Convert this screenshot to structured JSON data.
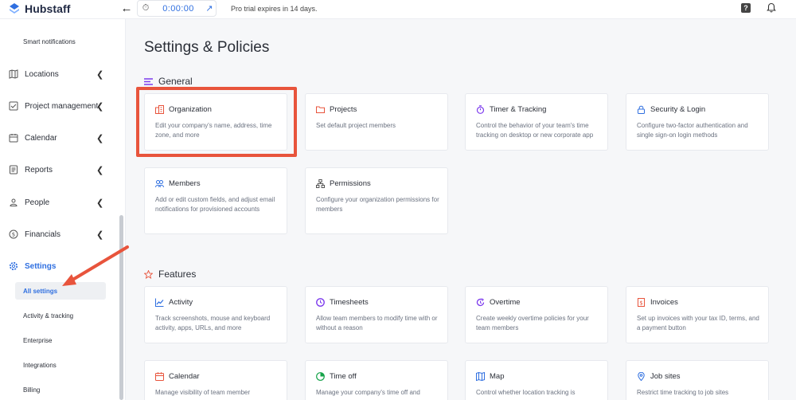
{
  "app": {
    "name": "Hubstaff"
  },
  "topbar": {
    "timer_value": "0:00:00",
    "trial_text": "Pro trial expires in 14 days.",
    "back_icon": "arrow-left-icon",
    "help_icon": "question-icon",
    "help_glyph": "?",
    "notifications_icon": "bell-icon"
  },
  "sidebar": {
    "smart_notifications": "Smart notifications",
    "items": [
      {
        "label": "Locations",
        "icon": "map-icon"
      },
      {
        "label": "Project management",
        "icon": "checklist-icon"
      },
      {
        "label": "Calendar",
        "icon": "calendar-icon"
      },
      {
        "label": "Reports",
        "icon": "report-icon"
      },
      {
        "label": "People",
        "icon": "person-icon"
      },
      {
        "label": "Financials",
        "icon": "dollar-icon"
      },
      {
        "label": "Settings",
        "icon": "gear-icon"
      }
    ],
    "sub_items": [
      {
        "label": "All settings",
        "active": true
      },
      {
        "label": "Activity & tracking"
      },
      {
        "label": "Enterprise"
      },
      {
        "label": "Integrations"
      },
      {
        "label": "Billing"
      }
    ]
  },
  "main": {
    "title": "Settings & Policies",
    "general": {
      "title": "General",
      "cards": [
        {
          "title": "Organization",
          "desc": "Edit your company's name, address, time zone, and more",
          "icon": "building-icon",
          "color": "#e8543c"
        },
        {
          "title": "Projects",
          "desc": "Set default project members",
          "icon": "folder-icon",
          "color": "#e8543c"
        },
        {
          "title": "Timer & Tracking",
          "desc": "Control the behavior of your team's time tracking on desktop or new corporate app",
          "icon": "stopwatch-icon",
          "color": "#7c3aed"
        },
        {
          "title": "Security & Login",
          "desc": "Configure two-factor authentication and single sign-on login methods",
          "icon": "lock-icon",
          "color": "#2f6fe0"
        },
        {
          "title": "Members",
          "desc": "Add or edit custom fields, and adjust email notifications for provisioned accounts",
          "icon": "members-icon",
          "color": "#2f6fe0"
        },
        {
          "title": "Permissions",
          "desc": "Configure your organization permissions for members",
          "icon": "hierarchy-icon",
          "color": "#555"
        }
      ]
    },
    "features": {
      "title": "Features",
      "cards": [
        {
          "title": "Activity",
          "desc": "Track screenshots, mouse and keyboard activity, apps, URLs, and more",
          "icon": "activity-icon",
          "color": "#2f6fe0"
        },
        {
          "title": "Timesheets",
          "desc": "Allow team members to modify time with or without a reason",
          "icon": "clock-icon",
          "color": "#7c3aed"
        },
        {
          "title": "Overtime",
          "desc": "Create weekly overtime policies for your team members",
          "icon": "overtime-icon",
          "color": "#7c3aed"
        },
        {
          "title": "Invoices",
          "desc": "Set up invoices with your tax ID, terms, and a payment button",
          "icon": "invoice-icon",
          "color": "#e8543c"
        },
        {
          "title": "Calendar",
          "desc": "Manage visibility of team member",
          "icon": "calendar-icon",
          "color": "#e8543c"
        },
        {
          "title": "Time off",
          "desc": "Manage your company's time off and",
          "icon": "pie-icon",
          "color": "#16a34a"
        },
        {
          "title": "Map",
          "desc": "Control whether location tracking is",
          "icon": "map-icon",
          "color": "#2f6fe0"
        },
        {
          "title": "Job sites",
          "desc": "Restrict time tracking to job sites",
          "icon": "pin-icon",
          "color": "#2f6fe0"
        }
      ]
    }
  },
  "colors": {
    "accent": "#2f6fe0",
    "highlight": "#e8543c"
  }
}
